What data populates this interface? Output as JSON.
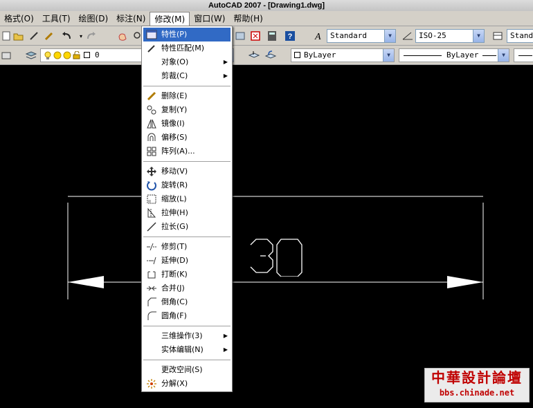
{
  "window": {
    "title": "AutoCAD 2007 - [Drawing1.dwg]"
  },
  "menubar": {
    "items": [
      {
        "label": "格式(O)"
      },
      {
        "label": "工具(T)"
      },
      {
        "label": "绘图(D)"
      },
      {
        "label": "标注(N)"
      },
      {
        "label": "修改(M)"
      },
      {
        "label": "窗口(W)"
      },
      {
        "label": "帮助(H)"
      }
    ]
  },
  "toolbar": {
    "text_style": "Standard",
    "dim_style": "ISO-25",
    "table_style": "Standa",
    "layer": "0",
    "color": "ByLayer",
    "linetype": "ByLayer"
  },
  "modify_menu": {
    "items": [
      {
        "label": "特性(P)"
      },
      {
        "label": "特性匹配(M)"
      },
      {
        "label": "对象(O)",
        "submenu_arrow": "▶"
      },
      {
        "label": "剪裁(C)",
        "submenu_arrow": "▶"
      },
      {
        "label": "删除(E)"
      },
      {
        "label": "复制(Y)"
      },
      {
        "label": "镜像(I)"
      },
      {
        "label": "偏移(S)"
      },
      {
        "label": "阵列(A)..."
      },
      {
        "label": "移动(V)"
      },
      {
        "label": "旋转(R)"
      },
      {
        "label": "缩放(L)"
      },
      {
        "label": "拉伸(H)"
      },
      {
        "label": "拉长(G)"
      },
      {
        "label": "修剪(T)"
      },
      {
        "label": "延伸(D)"
      },
      {
        "label": "打断(K)"
      },
      {
        "label": "合并(J)"
      },
      {
        "label": "倒角(C)"
      },
      {
        "label": "圆角(F)"
      },
      {
        "label": "三维操作(3)",
        "submenu_arrow": "▶"
      },
      {
        "label": "实体编辑(N)",
        "submenu_arrow": "▶"
      },
      {
        "label": "更改空间(S)"
      },
      {
        "label": "分解(X)"
      }
    ]
  },
  "drawing": {
    "dimension_text": "30"
  },
  "watermark": {
    "line1": "中華設計論壇",
    "line2": "bbs.chinade.net"
  }
}
